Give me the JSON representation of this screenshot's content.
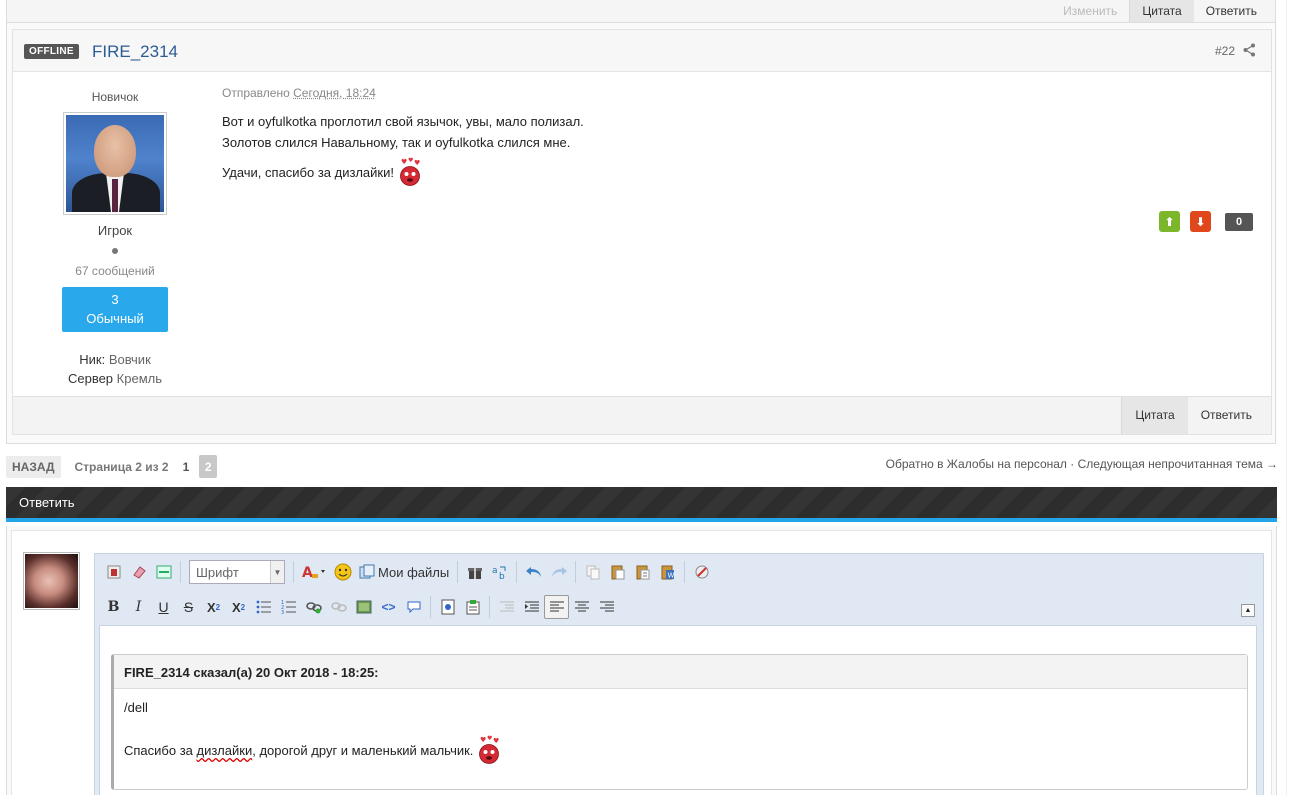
{
  "top_actions": {
    "edit": "Изменить",
    "quote": "Цитата",
    "reply": "Ответить"
  },
  "post": {
    "status_badge": "OFFLINE",
    "author": "FIRE_2314",
    "number": "#22",
    "rank_title": "Новичок",
    "group": "Игрок",
    "post_count": "67 сообщений",
    "reputation": {
      "value": "3",
      "label": "Обычный"
    },
    "fields": [
      {
        "label": "Ник:",
        "value": "Вовчик"
      },
      {
        "label": "Сервер",
        "value": "Кремль"
      }
    ],
    "posted_label": "Отправлено",
    "posted_time": "Сегодня, 18:24",
    "lines": [
      "Вот и oyfulkotka проглотил свой язычок, увы, мало полизал.",
      "Золотов слился Навальному, так и oyfulkotka слился мне.",
      "Удачи, спасибо за дизлайки!"
    ],
    "vote": {
      "up": "⬆",
      "down": "⬇",
      "score": "0"
    },
    "footer": {
      "quote": "Цитата",
      "reply": "Ответить"
    }
  },
  "pager": {
    "back": "НАЗАД",
    "page_of": "Страница 2 из 2",
    "page1": "1",
    "page2": "2",
    "nav_back_to": "Обратно в Жалобы на персонал",
    "sep": " · ",
    "next_unread": "Следующая непрочитанная тема →"
  },
  "reply": {
    "title": "Ответить",
    "font_placeholder": "Шрифт",
    "my_files": "Мои файлы",
    "quote_header": "FIRE_2314 сказал(а) 20 Окт 2018 - 18:25:",
    "quote_line1": "/dell",
    "quote_line2_pre": "Спасибо за ",
    "quote_line2_spell": "дизлайки",
    "quote_line2_post": ", дорогой друг и маленький мальчик."
  },
  "colors": {
    "accent": "#25a5e9",
    "reputation": "#2aa8ec",
    "vote_up": "#7bb62b",
    "vote_down": "#e0481b",
    "author_link": "#2c5b93"
  }
}
